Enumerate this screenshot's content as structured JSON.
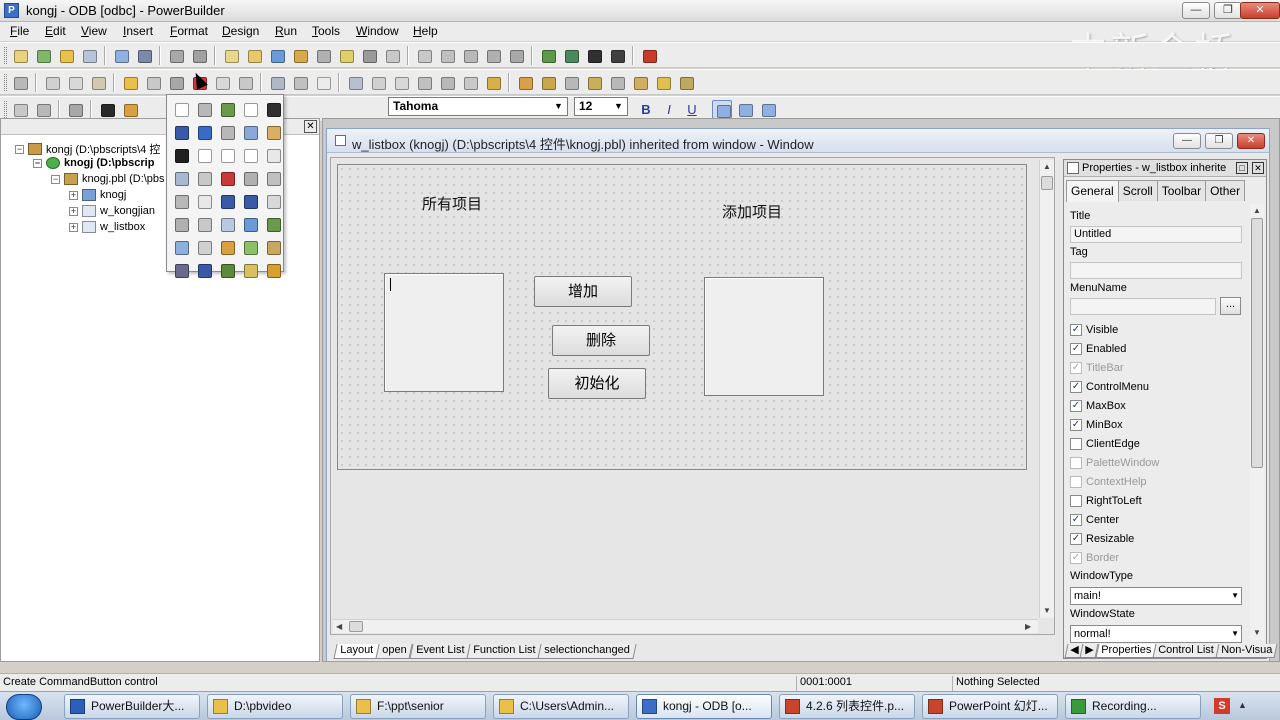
{
  "app": {
    "title": "kongj - ODB [odbc] - PowerBuilder",
    "icon": "powerbuilder-icon",
    "window_buttons": {
      "minimize": "—",
      "maximize": "❐",
      "close": "✕"
    }
  },
  "watermark": "中新金桥",
  "menu": [
    "File",
    "Edit",
    "View",
    "Insert",
    "Format",
    "Design",
    "Run",
    "Tools",
    "Window",
    "Help"
  ],
  "toolbar_font": {
    "font_name": "Tahoma",
    "font_size": "12",
    "bold": "B",
    "italic": "I",
    "underline": "U"
  },
  "library_tree": {
    "close_glyph": "✕",
    "items": [
      {
        "label": "kongj (D:\\pbscripts\\4 控",
        "expander": "−",
        "bold": false
      },
      {
        "label": "knogj (D:\\pbscrip",
        "expander": "−",
        "bold": true
      },
      {
        "label": "knogj.pbl (D:\\pbs",
        "expander": "−",
        "bold": false
      },
      {
        "label": "knogj",
        "expander": "+",
        "bold": false
      },
      {
        "label": "w_kongjian",
        "expander": "+",
        "bold": false
      },
      {
        "label": "w_listbox",
        "expander": "+",
        "bold": false
      }
    ]
  },
  "child_window": {
    "title": "w_listbox (knogj) (D:\\pbscripts\\4 控件\\knogj.pbl) inherited from window - Window",
    "buttons": {
      "minimize": "—",
      "maximize": "❐",
      "close": "✕"
    }
  },
  "design": {
    "label_all_items": "所有项目",
    "label_added_items": "添加项目",
    "btn_add": "增加",
    "btn_delete": "删除",
    "btn_init": "初始化"
  },
  "view_tabs": [
    "Layout",
    "open",
    "Event List",
    "Function List",
    "selectionchanged"
  ],
  "properties": {
    "title": "Properties - w_listbox inherite",
    "tabs": [
      "General",
      "Scroll",
      "Toolbar",
      "Other"
    ],
    "title_label": "Title",
    "title_value": "Untitled",
    "tag_label": "Tag",
    "tag_value": "",
    "menuname_label": "MenuName",
    "menuname_value": "",
    "browse_button": "...",
    "checkboxes": [
      {
        "label": "Visible",
        "checked": true,
        "enabled": true
      },
      {
        "label": "Enabled",
        "checked": true,
        "enabled": true
      },
      {
        "label": "TitleBar",
        "checked": true,
        "enabled": false
      },
      {
        "label": "ControlMenu",
        "checked": true,
        "enabled": true
      },
      {
        "label": "MaxBox",
        "checked": true,
        "enabled": true
      },
      {
        "label": "MinBox",
        "checked": true,
        "enabled": true
      },
      {
        "label": "ClientEdge",
        "checked": false,
        "enabled": true
      },
      {
        "label": "PaletteWindow",
        "checked": false,
        "enabled": false
      },
      {
        "label": "ContextHelp",
        "checked": false,
        "enabled": false
      },
      {
        "label": "RightToLeft",
        "checked": false,
        "enabled": true
      },
      {
        "label": "Center",
        "checked": true,
        "enabled": true
      },
      {
        "label": "Resizable",
        "checked": true,
        "enabled": true
      },
      {
        "label": "Border",
        "checked": true,
        "enabled": false
      }
    ],
    "windowtype_label": "WindowType",
    "windowtype_value": "main!",
    "windowstate_label": "WindowState",
    "windowstate_value": "normal!",
    "bottom_tabs": [
      "Properties",
      "Control List",
      "Non-Visua"
    ]
  },
  "status": {
    "message": "Create CommandButton control",
    "position": "0001:0001",
    "selection": "Nothing Selected"
  },
  "taskbar": [
    {
      "label": "PowerBuilder大...",
      "color": "#2b5fb8",
      "active": false
    },
    {
      "label": "D:\\pbvideo",
      "color": "#e8c04a",
      "active": false
    },
    {
      "label": "F:\\ppt\\senior",
      "color": "#e8c04a",
      "active": false
    },
    {
      "label": "C:\\Users\\Admin...",
      "color": "#e8c04a",
      "active": false
    },
    {
      "label": "kongj - ODB [o...",
      "color": "#3c6ec8",
      "active": true
    },
    {
      "label": "4.2.6 列表控件.p...",
      "color": "#c8442a",
      "active": false
    },
    {
      "label": "PowerPoint 幻灯...",
      "color": "#c8442a",
      "active": false
    },
    {
      "label": "Recording...",
      "color": "#3a9a3a",
      "active": false
    }
  ],
  "tray_icon": "S"
}
